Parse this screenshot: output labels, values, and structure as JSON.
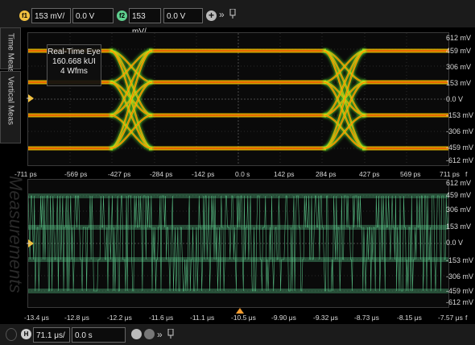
{
  "toolbar": {
    "ch1_badge": "f1",
    "ch1_scale": "153 mV/",
    "ch1_offset": "0.0 V",
    "ch2_badge": "f2",
    "ch2_scale": "153 mV/",
    "ch2_offset": "0.0 V",
    "add_icon": "plus-icon",
    "more_label": "»",
    "pin_icon": "pin-icon"
  },
  "side_tabs": [
    "Time Meas",
    "Vertical Meas"
  ],
  "eye_box": {
    "line1": "Real-Time Eye",
    "line2": "160.668 kUI",
    "line3": "4 Wfms"
  },
  "eye_plot": {
    "y_labels": [
      "612 mV",
      "459 mV",
      "306 mV",
      "153 mV",
      "0.0 V",
      "-153 mV",
      "-306 mV",
      "-459 mV",
      "-612 mV"
    ],
    "x_labels": [
      "-711 ps",
      "-569 ps",
      "-427 ps",
      "-284 ps",
      "-142 ps",
      "0.0 s",
      "142 ps",
      "284 ps",
      "427 ps",
      "569 ps",
      "711 ps"
    ],
    "colors": {
      "trace_hot": "#ff3300",
      "trace_mid": "#ffcc00",
      "trace_cool": "#66ff33"
    }
  },
  "record_plot": {
    "y_labels": [
      "612 mV",
      "459 mV",
      "306 mV",
      "153 mV",
      "0.0 V",
      "-153 mV",
      "-306 mV",
      "-459 mV",
      "-612 mV"
    ],
    "x_labels": [
      "-13.4 μs",
      "-12.8 μs",
      "-12.2 μs",
      "-11.6 μs",
      "-11.1 μs",
      "-10.5 μs",
      "-9.90 μs",
      "-9.32 μs",
      "-8.73 μs",
      "-8.15 μs",
      "-7.57 μs"
    ],
    "colors": {
      "trace": "#5fcf8f"
    }
  },
  "watermark": "Measurements",
  "bottom": {
    "h_badge": "H",
    "h_scale": "71.1 μs/",
    "h_position": "0.0 s",
    "more_label": "»",
    "pin_icon": "pin-icon",
    "units_label": "f"
  }
}
